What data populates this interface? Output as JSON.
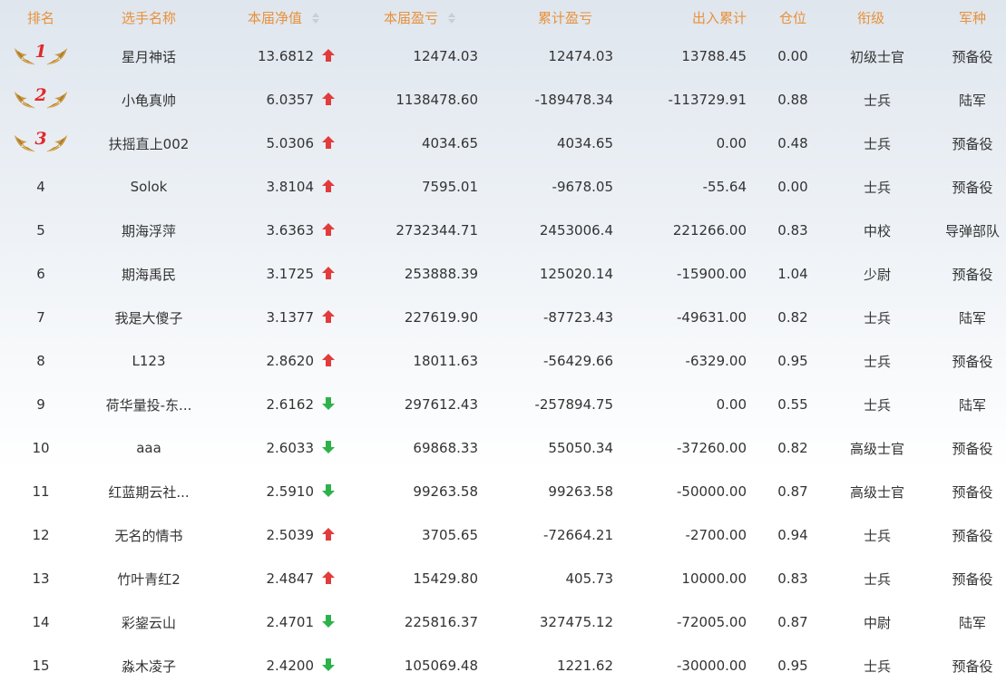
{
  "headers": {
    "rank": "排名",
    "name": "选手名称",
    "nav": "本届净值",
    "profit": "本届盈亏",
    "total_profit": "累计盈亏",
    "flow": "出入累计",
    "position": "仓位",
    "grade": "衔级",
    "branch": "军种"
  },
  "rows": [
    {
      "rank": "1",
      "name": "星月神话",
      "nav": "13.6812",
      "trend": "up",
      "profit": "12474.03",
      "total_profit": "12474.03",
      "flow": "13788.45",
      "position": "0.00",
      "grade": "初级士官",
      "branch": "预备役"
    },
    {
      "rank": "2",
      "name": "小龟真帅",
      "nav": "6.0357",
      "trend": "up",
      "profit": "1138478.60",
      "total_profit": "-189478.34",
      "flow": "-113729.91",
      "position": "0.88",
      "grade": "士兵",
      "branch": "陆军"
    },
    {
      "rank": "3",
      "name": "扶摇直上002",
      "nav": "5.0306",
      "trend": "up",
      "profit": "4034.65",
      "total_profit": "4034.65",
      "flow": "0.00",
      "position": "0.48",
      "grade": "士兵",
      "branch": "预备役"
    },
    {
      "rank": "4",
      "name": "Solok",
      "nav": "3.8104",
      "trend": "up",
      "profit": "7595.01",
      "total_profit": "-9678.05",
      "flow": "-55.64",
      "position": "0.00",
      "grade": "士兵",
      "branch": "预备役"
    },
    {
      "rank": "5",
      "name": "期海浮萍",
      "nav": "3.6363",
      "trend": "up",
      "profit": "2732344.71",
      "total_profit": "2453006.4",
      "flow": "221266.00",
      "position": "0.83",
      "grade": "中校",
      "branch": "导弹部队"
    },
    {
      "rank": "6",
      "name": "期海禹民",
      "nav": "3.1725",
      "trend": "up",
      "profit": "253888.39",
      "total_profit": "125020.14",
      "flow": "-15900.00",
      "position": "1.04",
      "grade": "少尉",
      "branch": "预备役"
    },
    {
      "rank": "7",
      "name": "我是大傻子",
      "nav": "3.1377",
      "trend": "up",
      "profit": "227619.90",
      "total_profit": "-87723.43",
      "flow": "-49631.00",
      "position": "0.82",
      "grade": "士兵",
      "branch": "陆军"
    },
    {
      "rank": "8",
      "name": "L123",
      "nav": "2.8620",
      "trend": "up",
      "profit": "18011.63",
      "total_profit": "-56429.66",
      "flow": "-6329.00",
      "position": "0.95",
      "grade": "士兵",
      "branch": "预备役"
    },
    {
      "rank": "9",
      "name": "荷华量投-东...",
      "nav": "2.6162",
      "trend": "down",
      "profit": "297612.43",
      "total_profit": "-257894.75",
      "flow": "0.00",
      "position": "0.55",
      "grade": "士兵",
      "branch": "陆军"
    },
    {
      "rank": "10",
      "name": "aaa",
      "nav": "2.6033",
      "trend": "down",
      "profit": "69868.33",
      "total_profit": "55050.34",
      "flow": "-37260.00",
      "position": "0.82",
      "grade": "高级士官",
      "branch": "预备役"
    },
    {
      "rank": "11",
      "name": "红蓝期云社...",
      "nav": "2.5910",
      "trend": "down",
      "profit": "99263.58",
      "total_profit": "99263.58",
      "flow": "-50000.00",
      "position": "0.87",
      "grade": "高级士官",
      "branch": "预备役"
    },
    {
      "rank": "12",
      "name": "无名的情书",
      "nav": "2.5039",
      "trend": "up",
      "profit": "3705.65",
      "total_profit": "-72664.21",
      "flow": "-2700.00",
      "position": "0.94",
      "grade": "士兵",
      "branch": "预备役"
    },
    {
      "rank": "13",
      "name": "竹叶青红2",
      "nav": "2.4847",
      "trend": "up",
      "profit": "15429.80",
      "total_profit": "405.73",
      "flow": "10000.00",
      "position": "0.83",
      "grade": "士兵",
      "branch": "预备役"
    },
    {
      "rank": "14",
      "name": "彩鋆云山",
      "nav": "2.4701",
      "trend": "down",
      "profit": "225816.37",
      "total_profit": "327475.12",
      "flow": "-72005.00",
      "position": "0.87",
      "grade": "中尉",
      "branch": "陆军"
    },
    {
      "rank": "15",
      "name": "淼木凌子",
      "nav": "2.4200",
      "trend": "down",
      "profit": "105069.48",
      "total_profit": "1221.62",
      "flow": "-30000.00",
      "position": "0.95",
      "grade": "士兵",
      "branch": "预备役"
    }
  ],
  "colors": {
    "header_text": "#e8913a",
    "up": "#e23b3b",
    "down": "#2db24a",
    "medal_number": "#e12a2a",
    "wing": "#c8963e"
  },
  "icons": {
    "sort": "sort-icon",
    "up": "arrow-up-icon",
    "down": "arrow-down-icon",
    "medal": "laurel-wing-icon"
  }
}
